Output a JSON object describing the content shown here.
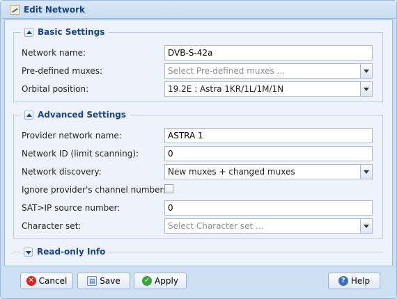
{
  "window": {
    "title": "Edit Network"
  },
  "basic": {
    "legend": "Basic Settings",
    "network_name": {
      "label": "Network name:",
      "value": "DVB-S-42a"
    },
    "predefined_muxes": {
      "label": "Pre-defined muxes:",
      "placeholder": "Select Pre-defined muxes ..."
    },
    "orbital_position": {
      "label": "Orbital position:",
      "value": "19.2E : Astra 1KR/1L/1M/1N"
    }
  },
  "advanced": {
    "legend": "Advanced Settings",
    "provider_network_name": {
      "label": "Provider network name:",
      "value": "ASTRA 1"
    },
    "network_id": {
      "label": "Network ID (limit scanning):",
      "value": "0"
    },
    "network_discovery": {
      "label": "Network discovery:",
      "value": "New muxes + changed muxes"
    },
    "ignore_channel_numbers": {
      "label": "Ignore provider's channel numbers:",
      "checked": false
    },
    "satip_source": {
      "label": "SAT>IP source number:",
      "value": "0"
    },
    "charset": {
      "label": "Character set:",
      "placeholder": "Select Character set ..."
    }
  },
  "readonly": {
    "legend": "Read-only Info"
  },
  "buttons": {
    "cancel": "Cancel",
    "save": "Save",
    "apply": "Apply",
    "help": "Help"
  },
  "icons": {
    "title": "edit-network-icon",
    "cancel": "cancel-icon",
    "save": "save-icon",
    "apply": "apply-check-icon",
    "help": "help-icon"
  },
  "colors": {
    "accent": "#15428b",
    "border": "#99bbe8"
  }
}
